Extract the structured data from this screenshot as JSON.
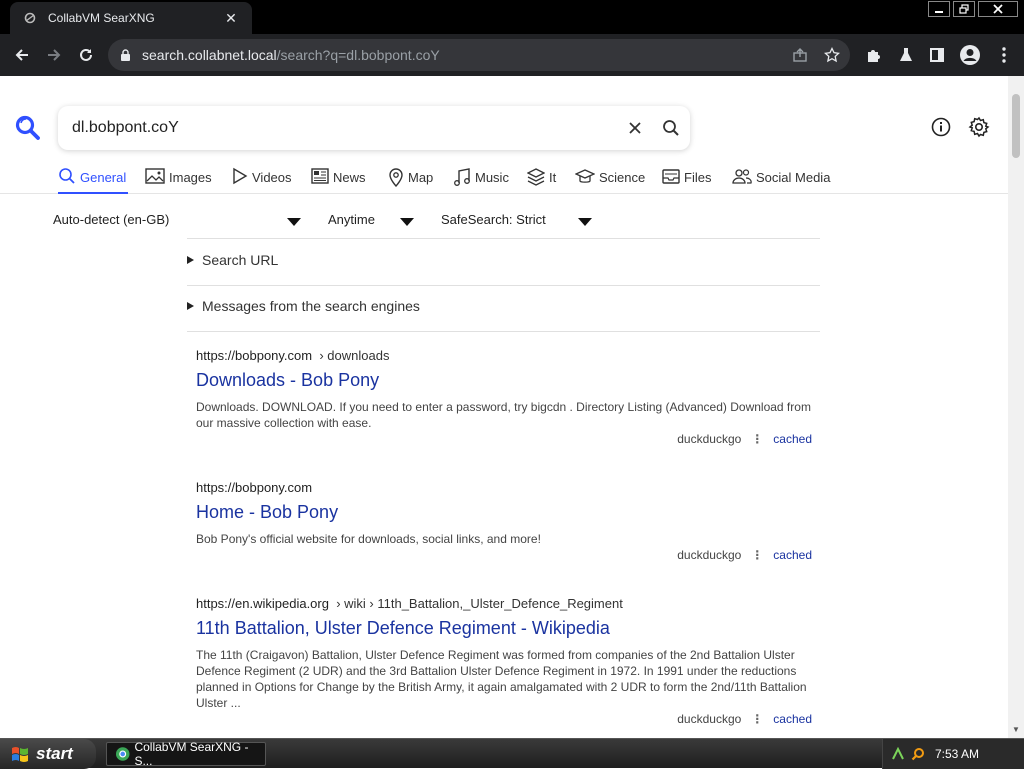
{
  "browser": {
    "tab_title": "CollabVM SearXNG",
    "url_host": "search.collabnet.local",
    "url_path": "/search?q=dl.bobpont.coY"
  },
  "search": {
    "query": "dl.bobpont.coY"
  },
  "categories": [
    {
      "label": "General",
      "icon": "magnifier-icon",
      "active": true
    },
    {
      "label": "Images",
      "icon": "image-icon"
    },
    {
      "label": "Videos",
      "icon": "play-icon"
    },
    {
      "label": "News",
      "icon": "newspaper-icon"
    },
    {
      "label": "Map",
      "icon": "map-pin-icon"
    },
    {
      "label": "Music",
      "icon": "music-note-icon"
    },
    {
      "label": "It",
      "icon": "layers-icon"
    },
    {
      "label": "Science",
      "icon": "mortarboard-icon"
    },
    {
      "label": "Files",
      "icon": "inbox-icon"
    },
    {
      "label": "Social Media",
      "icon": "people-icon"
    }
  ],
  "filters": {
    "language": "Auto-detect (en-GB)",
    "time": "Anytime",
    "safesearch": "SafeSearch: Strict"
  },
  "expanders": {
    "search_url": "Search URL",
    "messages": "Messages from the search engines"
  },
  "results": [
    {
      "url": "https://bobpony.com",
      "breadcrumb": "› downloads",
      "title": "Downloads - Bob Pony",
      "content": "Downloads. DOWNLOAD. If you need to enter a password, try bigcdn . Directory Listing (Advanced) Download from our massive collection with ease.",
      "engine": "duckduckgo",
      "cached": "cached"
    },
    {
      "url": "https://bobpony.com",
      "breadcrumb": "",
      "title": "Home - Bob Pony",
      "content": "Bob Pony's official website for downloads, social links, and more!",
      "engine": "duckduckgo",
      "cached": "cached"
    },
    {
      "url": "https://en.wikipedia.org",
      "breadcrumb": "› wiki › 11th_Battalion,_Ulster_Defence_Regiment",
      "title": "11th Battalion, Ulster Defence Regiment - Wikipedia",
      "content": "The 11th (Craigavon) Battalion, Ulster Defence Regiment was formed from companies of the 2nd Battalion Ulster Defence Regiment (2 UDR) and the 3rd Battalion Ulster Defence Regiment in 1972. In 1991 under the reductions planned in Options for Change by the British Army, it again amalgamated with 2 UDR to form the 2nd/11th Battalion Ulster ...",
      "engine": "duckduckgo",
      "cached": "cached"
    }
  ],
  "taskbar": {
    "start_label": "start",
    "task_label": "CollabVM SearXNG - S...",
    "clock": "7:53 AM"
  },
  "colors": {
    "accent": "#3050ff",
    "link": "#1a33a0"
  }
}
